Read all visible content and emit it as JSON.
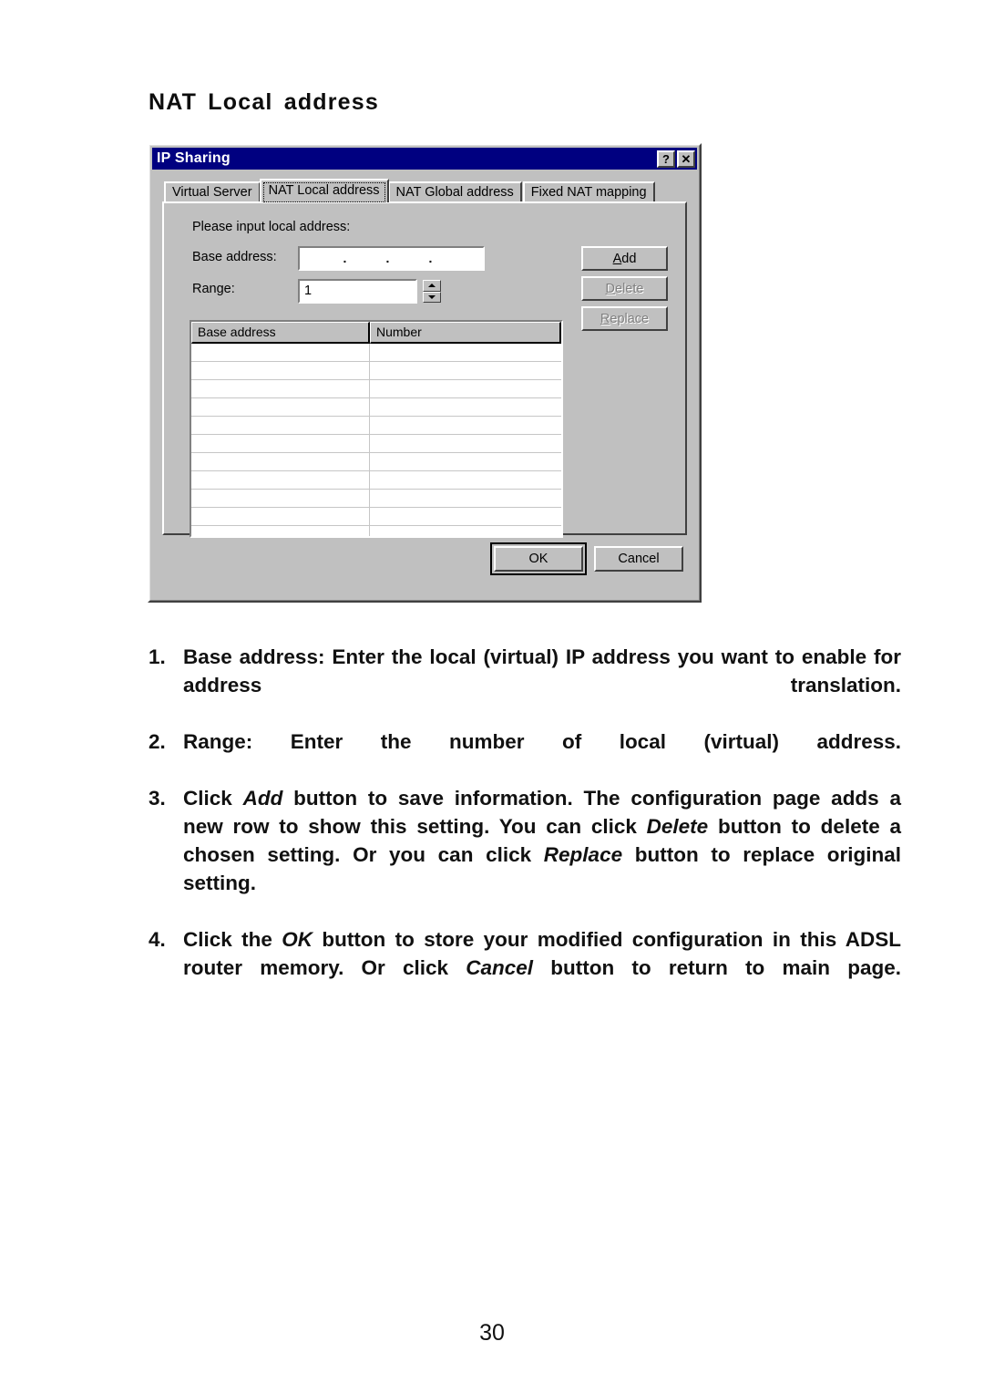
{
  "page": {
    "heading": "NAT  Local  address",
    "number": "30"
  },
  "dialog": {
    "title": "IP Sharing",
    "title_buttons": [
      {
        "name": "help-button",
        "glyph": "?"
      },
      {
        "name": "close-button",
        "glyph": "✕"
      }
    ],
    "tabs": [
      {
        "label": "Virtual Server",
        "selected": false
      },
      {
        "label": "NAT Local address",
        "selected": true
      },
      {
        "label": "NAT Global address",
        "selected": false
      },
      {
        "label": "Fixed NAT mapping",
        "selected": false
      }
    ],
    "form": {
      "hint": "Please input local address:",
      "base_address_label": "Base address:",
      "base_address_value": "",
      "base_address_separators": [
        ".",
        ".",
        "."
      ],
      "range_label": "Range:",
      "range_value": "1"
    },
    "side_buttons": [
      {
        "label": "Add",
        "accel": "A",
        "rest": "dd",
        "enabled": true
      },
      {
        "label": "Delete",
        "accel": "D",
        "rest": "elete",
        "enabled": false
      },
      {
        "label": "Replace",
        "accel": "R",
        "rest": "eplace",
        "enabled": false
      }
    ],
    "table": {
      "columns": [
        "Base address",
        "Number"
      ],
      "rows": [
        [
          "",
          ""
        ],
        [
          "",
          ""
        ],
        [
          "",
          ""
        ],
        [
          "",
          ""
        ],
        [
          "",
          ""
        ],
        [
          "",
          ""
        ],
        [
          "",
          ""
        ],
        [
          "",
          ""
        ],
        [
          "",
          ""
        ],
        [
          "",
          ""
        ],
        [
          "",
          ""
        ]
      ]
    },
    "bottom_buttons": [
      {
        "label": "OK",
        "default": true
      },
      {
        "label": "Cancel",
        "default": false
      }
    ]
  },
  "instructions": [
    {
      "number": "1.",
      "segments": [
        {
          "text": "Base address: Enter the local (virtual) IP address you want to enable for address translation.",
          "italic": false
        }
      ]
    },
    {
      "number": "2.",
      "segments": [
        {
          "text": "Range: Enter the number of local (virtual) address.",
          "italic": false
        }
      ]
    },
    {
      "number": "3.",
      "segments": [
        {
          "text": "Click ",
          "italic": false
        },
        {
          "text": "Add",
          "italic": true
        },
        {
          "text": " button to save information.  The configuration page adds a new row to show this setting.  You can click ",
          "italic": false
        },
        {
          "text": "Delete",
          "italic": true
        },
        {
          "text": " button to delete a chosen setting.  Or you can click ",
          "italic": false
        },
        {
          "text": "Replace",
          "italic": true
        },
        {
          "text": " button to replace original setting.",
          "italic": false
        }
      ]
    },
    {
      "number": "4.",
      "segments": [
        {
          "text": "Click the ",
          "italic": false
        },
        {
          "text": "OK",
          "italic": true
        },
        {
          "text": " button to store your modified configuration in this ADSL router memory.  Or click ",
          "italic": false
        },
        {
          "text": "Cancel",
          "italic": true
        },
        {
          "text": " button to return to main page.",
          "italic": false
        }
      ]
    }
  ]
}
